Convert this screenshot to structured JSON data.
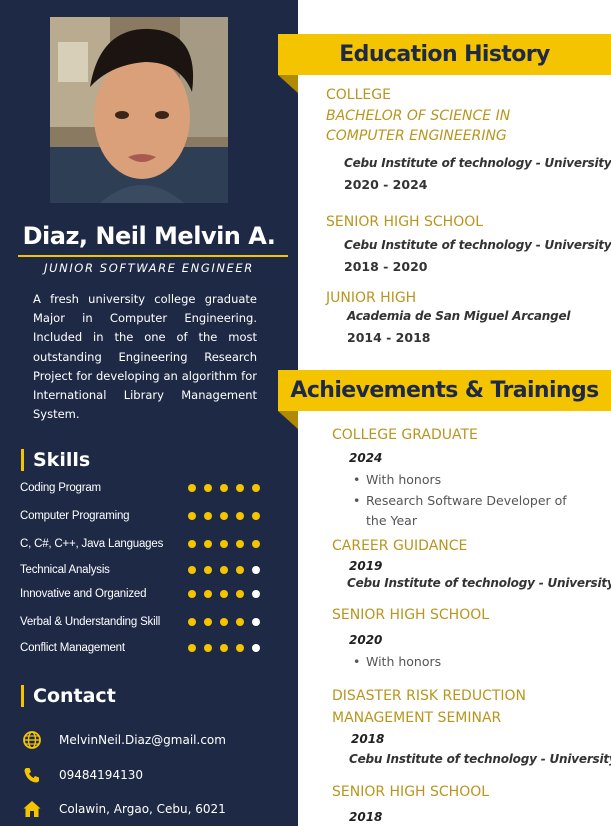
{
  "profile": {
    "name": "Diaz, Neil Melvin A.",
    "title": "JUNIOR SOFTWARE ENGINEER",
    "summary": "A fresh university college graduate Major in Computer Engineering. Included in the one of the most outstanding Engineering Research Project for developing an algorithm for International Library Management System."
  },
  "skills": {
    "heading": "Skills",
    "items": [
      {
        "label": "Coding Program",
        "level": 5
      },
      {
        "label": "Computer Programing",
        "level": 5
      },
      {
        "label": "C, C#, C++, Java Languages",
        "level": 5
      },
      {
        "label": "Technical Analysis",
        "level": 4
      },
      {
        "label": "Innovative and Organized",
        "level": 4
      },
      {
        "label": "Verbal & Understanding Skill",
        "level": 4
      },
      {
        "label": "Conflict Management",
        "level": 4
      }
    ],
    "max_level": 5
  },
  "contact": {
    "heading": "Contact",
    "email": "MelvinNeil.Diaz@gmail.com",
    "phone": "09484194130",
    "address": "Colawin, Argao, Cebu, 6021"
  },
  "education": {
    "heading": "Education History",
    "college_level": "COLLEGE",
    "college_degree": "BACHELOR OF SCIENCE IN COMPUTER ENGINEERING",
    "college_school": "Cebu Institute of technology - University",
    "college_years": "2020 - 2024",
    "shs_level": "SENIOR HIGH SCHOOL",
    "shs_school": "Cebu Institute of technology - University",
    "shs_years": "2018 - 2020",
    "jh_level": "JUNIOR HIGH",
    "jh_school": "Academia de San Miguel Arcangel",
    "jh_years": "2014 - 2018"
  },
  "achievements": {
    "heading": "Achievements & Trainings",
    "a1_title": "COLLEGE GRADUATE",
    "a1_year": "2024",
    "a1_b1": "With honors",
    "a1_b2": "Research Software Developer of the Year",
    "a2_title": "CAREER GUIDANCE",
    "a2_year": "2019",
    "a2_school": "Cebu Institute of technology - University",
    "a3_title": "SENIOR HIGH SCHOOL",
    "a3_year": "2020",
    "a3_b1": "With honors",
    "a4_title": "DISASTER RISK REDUCTION MANAGEMENT SEMINAR",
    "a4_year": "2018",
    "a4_school": "Cebu Institute of technology - University",
    "a5_title": "SENIOR HIGH SCHOOL",
    "a5_year": "2018"
  },
  "colors": {
    "navy": "#1e2a45",
    "accent": "#f5c400",
    "gold_text": "#b8961e",
    "dot_empty": "#ffffff"
  },
  "icons": {
    "email": "globe-icon",
    "phone": "phone-icon",
    "address": "home-icon"
  }
}
